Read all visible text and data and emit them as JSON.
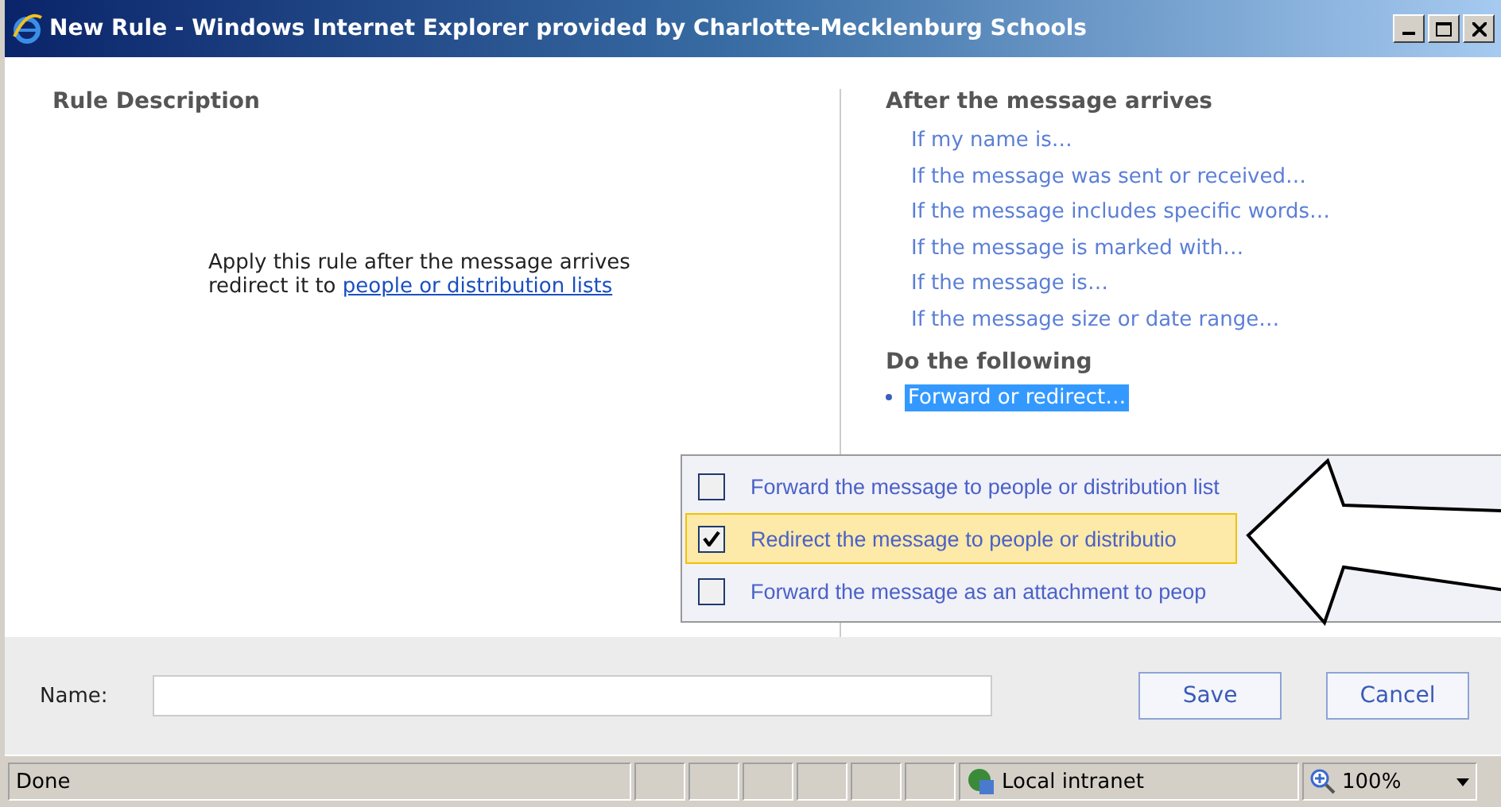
{
  "window": {
    "title": "New Rule - Windows Internet Explorer provided by Charlotte-Mecklenburg Schools"
  },
  "rule_description": {
    "heading": "Rule Description",
    "line_1": "Apply this rule after the message arrives",
    "line_2": "redirect it to ",
    "link": "people or distribution lists"
  },
  "conditions": {
    "heading": "After the message arrives",
    "items": [
      "If my name is…",
      "If the message was sent or received…",
      "If the message includes specific words…",
      "If the message is marked with…",
      "If the message is…",
      "If the message size or date range…"
    ]
  },
  "actions": {
    "heading": "Do the following",
    "items": [
      {
        "label": "Forward or redirect…",
        "selected": true
      }
    ]
  },
  "menu": {
    "items": [
      {
        "label": "Forward the message to people or distribution list",
        "checked": false,
        "selected": false
      },
      {
        "label": "Redirect the message to people or distributio",
        "checked": true,
        "selected": true
      },
      {
        "label": "Forward the message as an attachment to peop",
        "checked": false,
        "selected": false
      }
    ]
  },
  "name_field": {
    "label": "Name:"
  },
  "buttons": [
    "Save",
    "Cancel"
  ],
  "status_bar": {
    "text": "Done",
    "zone": "Local intranet",
    "zoom": "100%"
  }
}
